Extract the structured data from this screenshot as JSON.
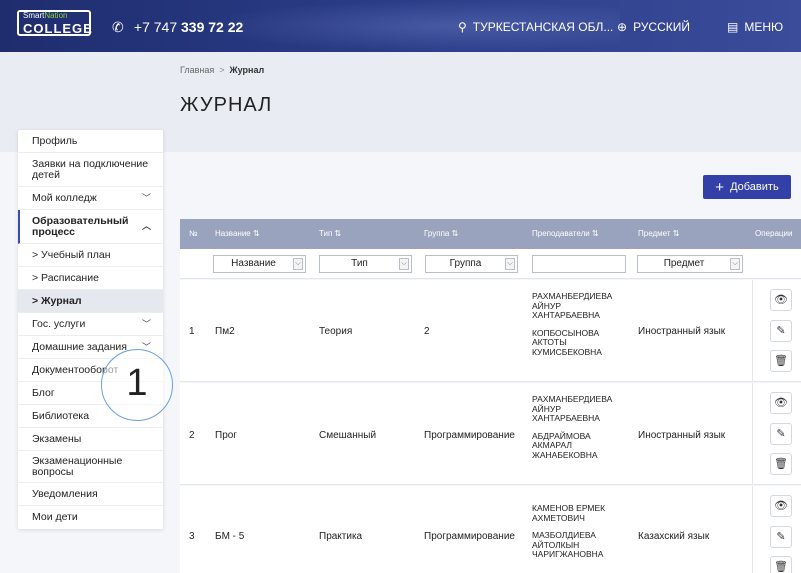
{
  "header": {
    "logo_top": "SmartNation",
    "logo_top_a": "Smart",
    "logo_top_b": "Nation",
    "logo_main": "COLLEGE",
    "phone_prefix": "+7 747",
    "phone_number": "339 72 22",
    "region": "ТУРКЕСТАНСКАЯ ОБЛ...",
    "language": "РУССКИЙ",
    "menu": "МЕНЮ",
    "icons": {
      "phone": "phone-icon",
      "region": "location-pin-icon",
      "language": "globe-icon",
      "menu": "menu-icon"
    }
  },
  "breadcrumb": {
    "home": "Главная",
    "separator": ">",
    "current": "Журнал"
  },
  "page_title": "ЖУРНАЛ",
  "sidebar": {
    "items": [
      {
        "label": "Профиль"
      },
      {
        "label": "Заявки на подключение детей"
      },
      {
        "label": "Мой колледж",
        "chevron": "﹀"
      },
      {
        "label": "Образовательный процесс",
        "chevron": "︿"
      },
      {
        "label": "> Учебный план"
      },
      {
        "label": "> Расписание"
      },
      {
        "label": "> Журнал"
      },
      {
        "label": "Гос. услуги",
        "chevron": "﹀"
      },
      {
        "label": "Домашние задания",
        "chevron": "﹀"
      },
      {
        "label": "Документооборот"
      },
      {
        "label": "Блог"
      },
      {
        "label": "Библиотека"
      },
      {
        "label": "Экзамены"
      },
      {
        "label": "Экзаменационные вопросы"
      },
      {
        "label": "Уведомления"
      },
      {
        "label": "Мои дети"
      }
    ]
  },
  "callout_number": "1",
  "add_button": {
    "label": "Добавить",
    "icon": "+"
  },
  "table": {
    "columns": [
      "№",
      "Название ⇅",
      "Тип ⇅",
      "Группа ⇅",
      "Преподаватели ⇅",
      "Предмет ⇅",
      "Операции"
    ],
    "filters": {
      "name": "Название",
      "type": "Тип",
      "group": "Группа",
      "teacher": "",
      "subject": "Предмет"
    },
    "rows": [
      {
        "num": "1",
        "name": "Пм2",
        "type": "Теория",
        "group": "2",
        "teachers": [
          [
            "РАХМАНБЕРДИЕВА",
            "АЙНУР",
            "ХАНТАРБАЕВНА"
          ],
          [
            "КОПБОСЫНОВА",
            "АКТОТЫ",
            "КУМИСБЕКОВНА"
          ]
        ],
        "subject": "Иностранный язык"
      },
      {
        "num": "2",
        "name": "Прог",
        "type": "Смешанный",
        "group": "Программирование",
        "teachers": [
          [
            "РАХМАНБЕРДИЕВА",
            "АЙНУР",
            "ХАНТАРБАЕВНА"
          ],
          [
            "АБДРАЙМОВА",
            "АКМАРАЛ",
            "ЖАНАБЕКОВНА"
          ]
        ],
        "subject": "Иностранный язык"
      },
      {
        "num": "3",
        "name": "БМ - 5",
        "type": "Практика",
        "group": "Программирование",
        "teachers": [
          [
            "КАМЕНОВ ЕРМЕК",
            "АХМЕТОВИЧ"
          ],
          [
            "МАЗБОЛДИЕВА",
            "АЙТОЛКЫН",
            "ЧАРИГЖАНОВНА"
          ]
        ],
        "subject": "Казахский язык"
      }
    ],
    "operations": {
      "view": "👁",
      "edit": "✎",
      "delete": "🗑"
    }
  },
  "colors": {
    "header": "#24337a",
    "accent": "#3340a8",
    "table_header": "#9aa3bd"
  }
}
